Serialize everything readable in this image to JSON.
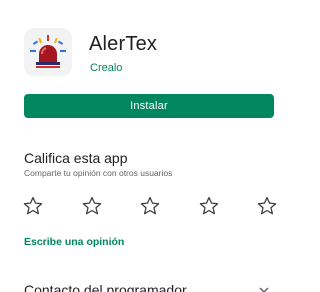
{
  "app": {
    "name": "AlerTex",
    "developer": "Crealo",
    "icon": "siren-icon"
  },
  "install": {
    "label": "Instalar"
  },
  "rating": {
    "title": "Califica esta app",
    "subtitle": "Comparte tu opinión con otros usuarios",
    "stars": [
      {
        "icon": "star-outline-icon"
      },
      {
        "icon": "star-outline-icon"
      },
      {
        "icon": "star-outline-icon"
      },
      {
        "icon": "star-outline-icon"
      },
      {
        "icon": "star-outline-icon"
      }
    ],
    "write_review": "Escribe una opinión"
  },
  "contact": {
    "title": "Contacto del programador",
    "icon": "chevron-down-icon"
  },
  "colors": {
    "accent": "#01875f",
    "siren": "#a4171f"
  }
}
